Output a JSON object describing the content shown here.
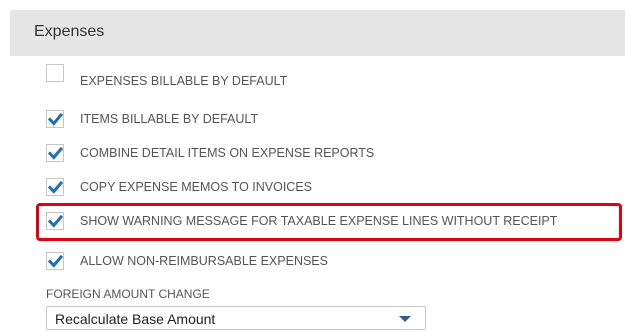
{
  "section": {
    "title": "Expenses"
  },
  "options": [
    {
      "label": "EXPENSES BILLABLE BY DEFAULT",
      "checked": false
    },
    {
      "label": "ITEMS BILLABLE BY DEFAULT",
      "checked": true
    },
    {
      "label": "COMBINE DETAIL ITEMS ON EXPENSE REPORTS",
      "checked": true
    },
    {
      "label": "COPY EXPENSE MEMOS TO INVOICES",
      "checked": true
    },
    {
      "label": "SHOW WARNING MESSAGE FOR TAXABLE EXPENSE LINES WITHOUT RECEIPT",
      "checked": true,
      "highlighted": true
    },
    {
      "label": "ALLOW NON-REIMBURSABLE EXPENSES",
      "checked": true
    }
  ],
  "foreign_amount": {
    "label": "FOREIGN AMOUNT CHANGE",
    "value": "Recalculate Base Amount"
  },
  "colors": {
    "header_bg": "#e6e6e6",
    "checkmark": "#1f6fb5",
    "highlight_border": "#e3000f",
    "dropdown_arrow": "#3a5a8c"
  }
}
